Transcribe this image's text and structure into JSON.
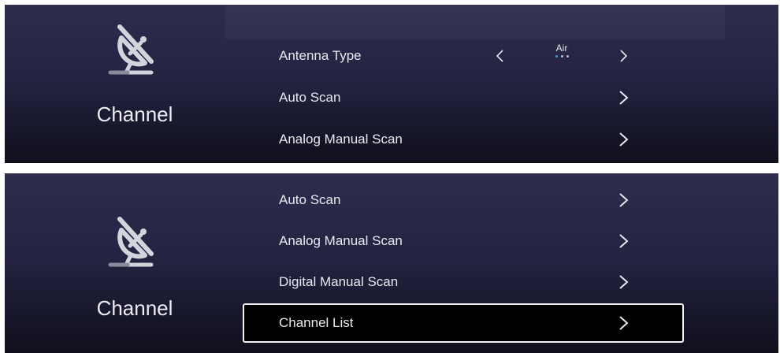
{
  "colors": {
    "accent": "#2fa8e8",
    "panel_bg_top": "#2e2d4e",
    "panel_bg_bottom": "#0f0f1c",
    "text": "#e8e8ef",
    "selection_border": "#f2f2f6"
  },
  "panel_top": {
    "category": {
      "title": "Channel",
      "icon": "satellite-dish-off-icon"
    },
    "rows": [
      {
        "label": "Antenna Type",
        "value": "Air",
        "option_count": 3,
        "selected_option": 1
      },
      {
        "label": "Auto Scan"
      },
      {
        "label": "Analog Manual Scan"
      }
    ]
  },
  "panel_bottom": {
    "category": {
      "title": "Channel",
      "icon": "satellite-dish-off-icon"
    },
    "rows": [
      {
        "label": "Auto Scan"
      },
      {
        "label": "Analog Manual Scan"
      },
      {
        "label": "Digital Manual Scan"
      },
      {
        "label": "Channel List",
        "selected": true
      }
    ]
  }
}
